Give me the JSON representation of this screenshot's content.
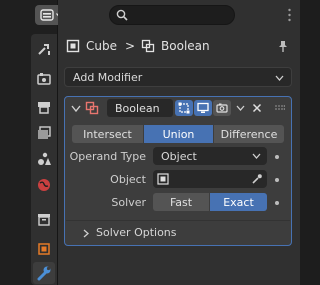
{
  "header": {
    "search_placeholder": ""
  },
  "breadcrumb": {
    "object": "Cube",
    "separator": ">",
    "modifier": "Boolean"
  },
  "add_modifier_label": "Add Modifier",
  "modifier": {
    "name": "Boolean",
    "operations": [
      "Intersect",
      "Union",
      "Difference"
    ],
    "active_operation": "Union",
    "operand_type_label": "Operand Type",
    "operand_type_value": "Object",
    "object_label": "Object",
    "object_value": "",
    "solver_label": "Solver",
    "solver_options": [
      "Fast",
      "Exact"
    ],
    "active_solver": "Exact",
    "solver_options_label": "Solver Options"
  },
  "colors": {
    "accent": "#4772b3",
    "modifier_icon": "#e8756f",
    "orange": "#e67a27",
    "wrench": "#4b8fd6"
  },
  "tabs": [
    "tool-icon",
    "render-icon",
    "output-icon",
    "view-layer-icon",
    "scene-icon",
    "world-icon",
    "collection-icon",
    "object-icon",
    "modifier-icon"
  ]
}
